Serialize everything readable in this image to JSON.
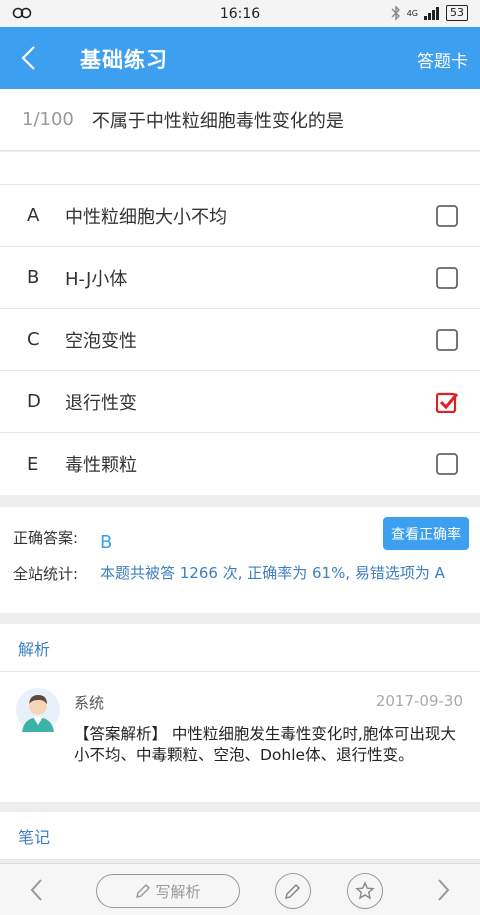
{
  "statusbar": {
    "time": "16:16",
    "battery": "53",
    "network": "4G"
  },
  "header": {
    "title": "基础练习",
    "answer_card": "答题卡"
  },
  "question": {
    "number": "1/100",
    "text": "不属于中性粒细胞毒性变化的是"
  },
  "options": [
    {
      "letter": "A",
      "text": "中性粒细胞大小不均",
      "checked": false
    },
    {
      "letter": "B",
      "text": "H-J小体",
      "checked": false
    },
    {
      "letter": "C",
      "text": "空泡变性",
      "checked": false
    },
    {
      "letter": "D",
      "text": "退行性变",
      "checked": true
    },
    {
      "letter": "E",
      "text": "毒性颗粒",
      "checked": false
    }
  ],
  "answer": {
    "correct_label": "正确答案:",
    "correct_value": "B",
    "stats_label": "全站统计:",
    "stats_text": "本题共被答  1266 次,  正确率为 61%, 易错选项为 A",
    "check_rate_button": "查看正确率"
  },
  "analysis": {
    "heading": "解析",
    "author": "系统",
    "date": "2017-09-30",
    "body": "【答案解析】 中性粒细胞发生毒性变化时,胞体可出现大小不均、中毒颗粒、空泡、Dohle体、退行性变。"
  },
  "notes": {
    "heading": "笔记"
  },
  "bottombar": {
    "write_label": "写解析"
  },
  "colors": {
    "accent": "#3d9ff0",
    "checked": "#e02020",
    "link": "#3d7fc0"
  }
}
